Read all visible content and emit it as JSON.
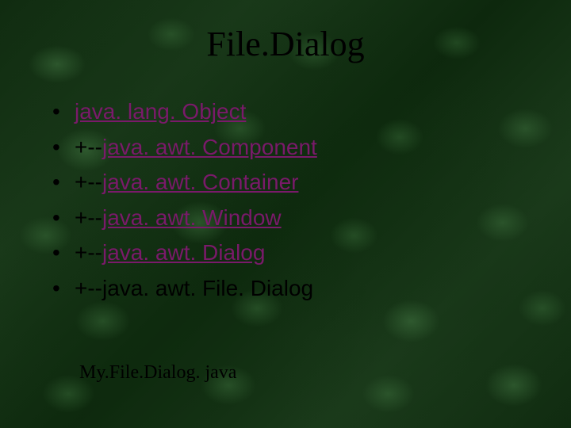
{
  "title": "File.Dialog",
  "items": [
    {
      "prefix": "",
      "link_text": "java. lang. Object",
      "plain_text": "",
      "is_link": true
    },
    {
      "prefix": "+--",
      "link_text": "java. awt. Component",
      "plain_text": "",
      "is_link": true
    },
    {
      "prefix": "+--",
      "link_text": "java. awt. Container",
      "plain_text": "",
      "is_link": true
    },
    {
      "prefix": "+--",
      "link_text": "java. awt. Window",
      "plain_text": "",
      "is_link": true
    },
    {
      "prefix": "+--",
      "link_text": "java. awt. Dialog",
      "plain_text": "",
      "is_link": true
    },
    {
      "prefix": "+--",
      "link_text": "",
      "plain_text": "java. awt. File. Dialog",
      "is_link": false
    }
  ],
  "footer": "My.File.Dialog. java",
  "colors": {
    "link": "#7a1a6a",
    "text": "#000000",
    "background_base": "#1a3a1a"
  }
}
